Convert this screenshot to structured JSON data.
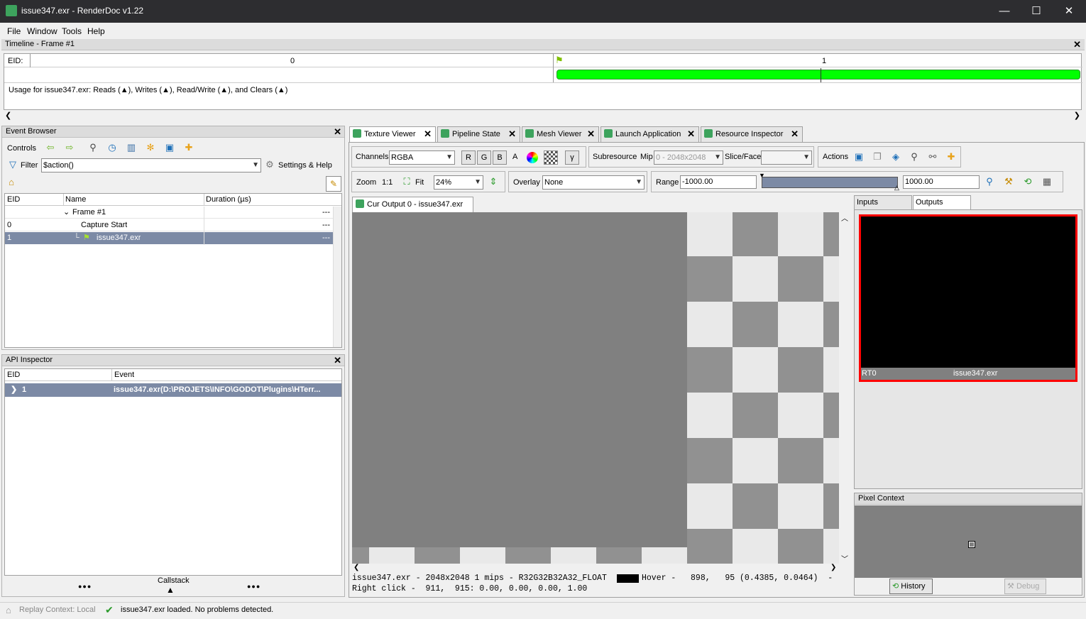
{
  "window": {
    "title": "issue347.exr - RenderDoc v1.22",
    "minimize": "—",
    "maximize": "☐",
    "close": "✕"
  },
  "menu": [
    "File",
    "Window",
    "Tools",
    "Help"
  ],
  "timeline": {
    "title": "Timeline - Frame #1",
    "eid_label": "EID:",
    "ticks": [
      "0",
      "1"
    ],
    "usage_text": "Usage for issue347.exr: Reads (▲), Writes (▲), Read/Write (▲), and Clears (▲)",
    "bar_color": "#00ff00"
  },
  "event_browser": {
    "title": "Event Browser",
    "controls_label": "Controls",
    "filter_label": "Filter",
    "filter_value": "$action()",
    "settings_label": "Settings & Help",
    "columns": [
      "EID",
      "Name",
      "Duration (µs)"
    ],
    "rows": [
      {
        "eid": "",
        "name": "Frame #1",
        "dur": "---"
      },
      {
        "eid": "0",
        "name": "Capture Start",
        "dur": "---"
      },
      {
        "eid": "1",
        "name": "issue347.exr",
        "dur": "---"
      }
    ]
  },
  "api_inspector": {
    "title": "API Inspector",
    "columns": [
      "EID",
      "Event"
    ],
    "row": {
      "eid": "1",
      "event": "issue347.exr(D:\\PROJETS\\INFO\\GODOT\\Plugins\\HTerr..."
    },
    "callstack_label": "Callstack",
    "dots": "●●●"
  },
  "tabs": [
    "Texture Viewer",
    "Pipeline State",
    "Mesh Viewer",
    "Launch Application",
    "Resource Inspector"
  ],
  "toolbar": {
    "channels_label": "Channels",
    "channels_value": "RGBA",
    "r": "R",
    "g": "G",
    "b": "B",
    "a": "A",
    "gamma": "γ",
    "subresource_label": "Subresource",
    "mip_label": "Mip",
    "mip_value": "0 - 2048x2048",
    "slice_label": "Slice/Face",
    "actions_label": "Actions",
    "zoom_label": "Zoom",
    "zoom_11": "1:1",
    "fit_label": "Fit",
    "zoom_value": "24%",
    "overlay_label": "Overlay",
    "overlay_value": "None",
    "range_label": "Range",
    "range_min": "-1000.00",
    "range_max": "1000.00"
  },
  "viewer": {
    "subtab": "Cur Output 0 - issue347.exr",
    "status_line1": "issue347.exr - 2048x2048 1 mips - R32G32B32A32_FLOAT",
    "hover_text": "Hover -   898,   95 (0.4385, 0.0464)  -",
    "status_line2": "Right click -  911,  915: 0.00, 0.00, 0.00, 1.00"
  },
  "right": {
    "tab_inputs": "Inputs",
    "tab_outputs": "Outputs",
    "thumb_label": "RT0",
    "thumb_name": "issue347.exr",
    "pixel_context_title": "Pixel Context",
    "history_button": "History",
    "debug_button": "Debug"
  },
  "statusbar": {
    "replay": "Replay Context: Local",
    "message": "issue347.exr loaded. No problems detected."
  },
  "colors": {
    "accent": "#3da35d",
    "selected_row": "#7c8aa5",
    "thumb_border": "#ff0000"
  }
}
